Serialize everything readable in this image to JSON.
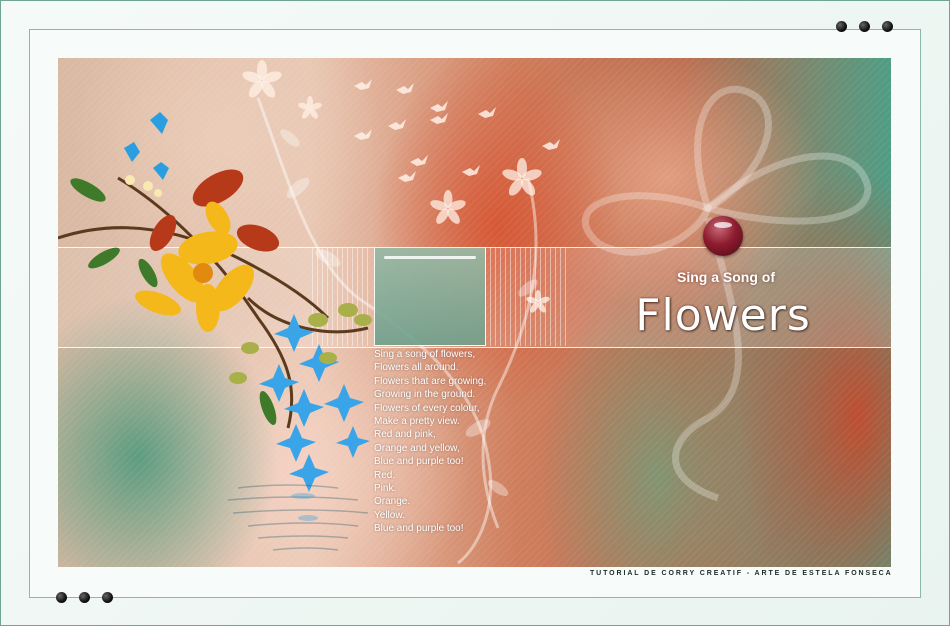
{
  "artwork": {
    "subtitle": "Sing a Song of",
    "title": "Flowers",
    "poem_lines": [
      "Sing a song of flowers,",
      "Flowers all around.",
      "Flowers that are growing,",
      "Growing in the ground.",
      "Flowers of every colour,",
      "Make a pretty view.",
      "Red and pink,",
      "Orange and yellow,",
      "Blue and purple too!",
      "Red.",
      "Pink.",
      "Orange.",
      "Yellow.",
      "Blue and purple too!"
    ]
  },
  "credit": "TUTORIAL DE CORRY CREATIF - ARTE DE ESTELA FONSECA",
  "colors": {
    "frame_border": "#6fa592",
    "bead": "#8e1c2e",
    "coral": "#d6563a",
    "teal": "#4f9d85"
  },
  "icons": [
    "bird-icon",
    "flower-icon",
    "bead-ornament",
    "flower-bouquet"
  ]
}
